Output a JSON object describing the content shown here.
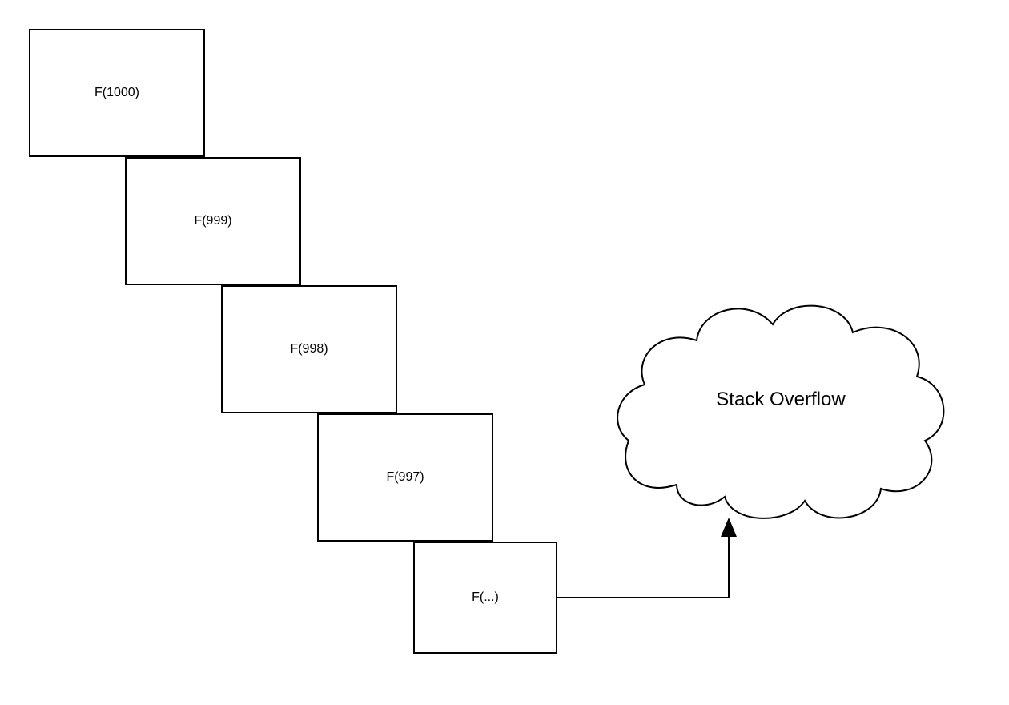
{
  "diagram": {
    "boxes": [
      {
        "label": "F(1000)"
      },
      {
        "label": "F(999)"
      },
      {
        "label": "F(998)"
      },
      {
        "label": "F(997)"
      },
      {
        "label": "F(...)"
      }
    ],
    "cloud_label": "Stack Overflow"
  }
}
